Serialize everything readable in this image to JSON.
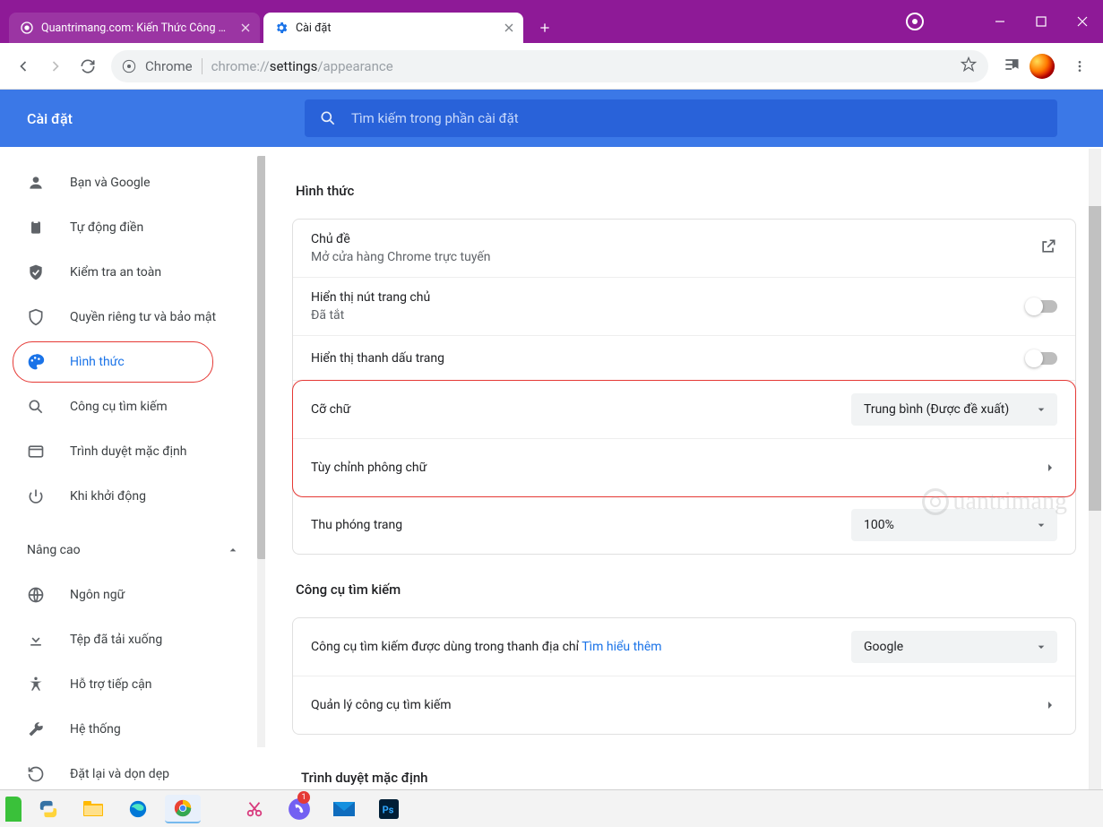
{
  "titlebar": {
    "tabs": [
      {
        "label": "Quantrimang.com: Kiến Thức Công Nghệ"
      },
      {
        "label": "Cài đặt"
      }
    ]
  },
  "toolbar": {
    "secure_label": "Chrome",
    "url_gray": "chrome://",
    "url_dark": "settings",
    "url_rest": "/appearance"
  },
  "header": {
    "title": "Cài đặt",
    "search_placeholder": "Tìm kiếm trong phần cài đặt"
  },
  "sidebar": {
    "items": [
      "Bạn và Google",
      "Tự động điền",
      "Kiểm tra an toàn",
      "Quyền riêng tư và bảo mật",
      "Hình thức",
      "Công cụ tìm kiếm",
      "Trình duyệt mặc định",
      "Khi khởi động"
    ],
    "advanced": "Nâng cao",
    "adv_items": [
      "Ngôn ngữ",
      "Tệp đã tải xuống",
      "Hỗ trợ tiếp cận",
      "Hệ thống",
      "Đặt lại và dọn dẹp"
    ]
  },
  "main": {
    "section_appearance": "Hình thức",
    "theme_label": "Chủ đề",
    "theme_sub": "Mở cửa hàng Chrome trực tuyến",
    "home_label": "Hiển thị nút trang chủ",
    "home_sub": "Đã tắt",
    "bookmark_bar": "Hiển thị thanh dấu trang",
    "font_size": "Cỡ chữ",
    "font_size_value": "Trung bình (Được đề xuất)",
    "customize_font": "Tùy chỉnh phông chữ",
    "zoom": "Thu phóng trang",
    "zoom_value": "100%",
    "section_search": "Công cụ tìm kiếm",
    "search_engine_label": "Công cụ tìm kiếm được dùng trong thanh địa chỉ",
    "learn_more": "Tìm hiểu thêm",
    "search_engine_value": "Google",
    "manage_search": "Quản lý công cụ tìm kiếm",
    "section_default": "Trình duyệt mặc định",
    "watermark": "uantrimang"
  },
  "taskbar": {
    "badge": "1"
  }
}
